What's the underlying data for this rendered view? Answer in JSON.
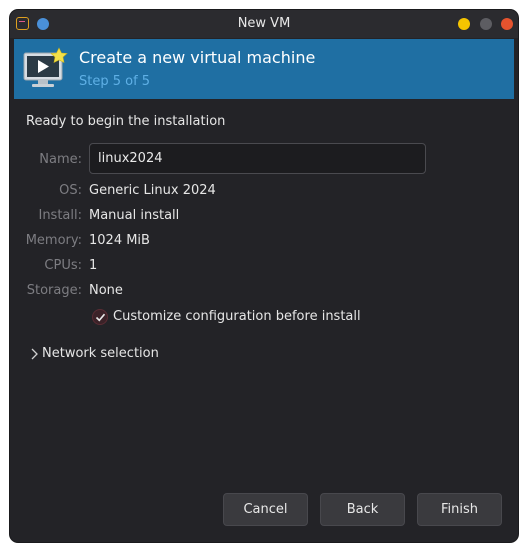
{
  "window": {
    "title": "New VM"
  },
  "header": {
    "title": "Create a new virtual machine",
    "step": "Step 5 of 5"
  },
  "summary": {
    "heading": "Ready to begin the installation",
    "name_label": "Name:",
    "name_value": "linux2024",
    "os_label": "OS:",
    "os_value": "Generic Linux 2024",
    "install_label": "Install:",
    "install_value": "Manual install",
    "memory_label": "Memory:",
    "memory_value": "1024 MiB",
    "cpus_label": "CPUs:",
    "cpus_value": "1",
    "storage_label": "Storage:",
    "storage_value": "None"
  },
  "customize": {
    "label": "Customize configuration before install",
    "checked": true
  },
  "network": {
    "label": "Network selection",
    "expanded": false
  },
  "buttons": {
    "cancel": "Cancel",
    "back": "Back",
    "finish": "Finish"
  },
  "colors": {
    "header_bg": "#1f6fa3",
    "window_bg": "#232327",
    "step_text": "#5fb0e6"
  },
  "icons": {
    "app": "virt-manager-icon",
    "header": "new-vm-monitor-icon",
    "expander": "chevron-right-icon",
    "check": "checkmark-icon"
  }
}
